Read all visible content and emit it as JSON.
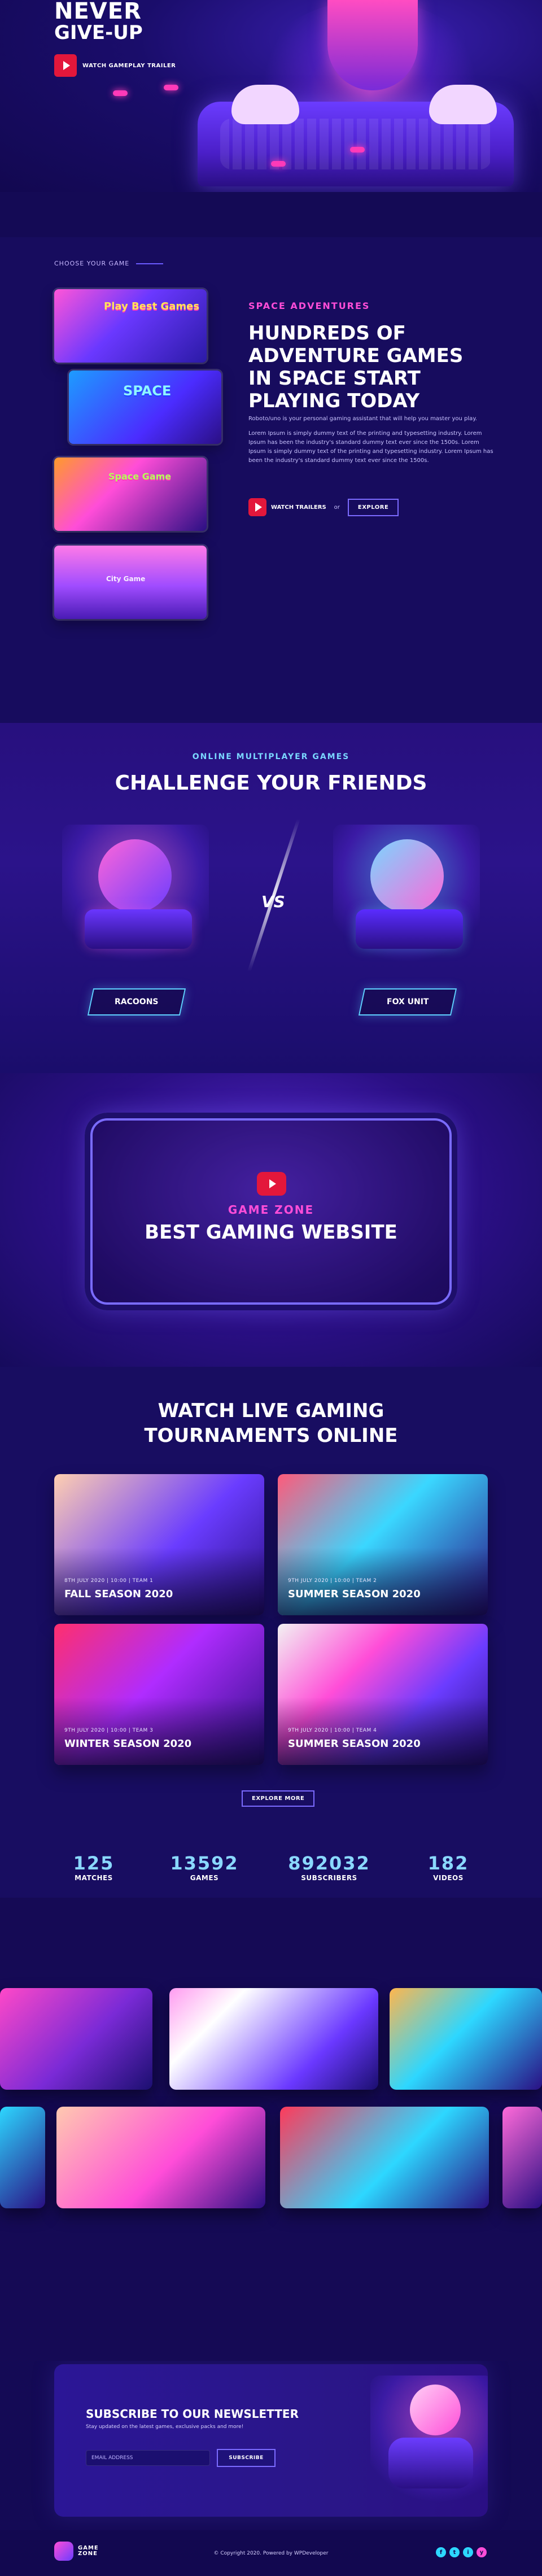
{
  "hero": {
    "title_line1": "NEVER",
    "title_line2": "GIVE-UP",
    "watch_label": "WATCH GAMEPLAY TRAILER"
  },
  "choose": {
    "eyebrow": "CHOOSE YOUR GAME",
    "tag": "SPACE ADVENTURES",
    "heading": "HUNDREDS OF ADVENTURE GAMES IN SPACE START PLAYING TODAY",
    "paragraph1": "Roboto/uno is your personal gaming assistant that will help you master you play.",
    "paragraph2": "Lorem Ipsum is simply dummy text of the printing and typesetting industry. Lorem Ipsum has been the industry's standard dummy text ever since the 1500s. Lorem Ipsum is simply dummy text of the printing and typesetting industry. Lorem Ipsum has been the industry's standard dummy text ever since the 1500s.",
    "watch_label": "WATCH TRAILERS",
    "or_label": "or",
    "explore_label": "EXPLORE",
    "thumbs": [
      {
        "title": "Play Best Games"
      },
      {
        "title": "SPACE"
      },
      {
        "title": "Space Game"
      },
      {
        "title": "City Game"
      }
    ]
  },
  "challenge": {
    "tag": "ONLINE MULTIPLAYER GAMES",
    "heading": "CHALLENGE YOUR FRIENDS",
    "vs": "VS",
    "team_left": "RACOONS",
    "team_right": "FOX UNIT"
  },
  "zone": {
    "tag": "GAME ZONE",
    "heading": "BEST GAMING WEBSITE"
  },
  "tournaments": {
    "heading_line1": "WATCH LIVE GAMING",
    "heading_line2": "TOURNAMENTS ONLINE",
    "cards": [
      {
        "date": "8TH JULY 2020 | 10:00 | TEAM 1",
        "title": "FALL SEASON 2020"
      },
      {
        "date": "9TH JULY 2020 | 10:00 | TEAM 2",
        "title": "SUMMER SEASON 2020"
      },
      {
        "date": "9TH JULY 2020 | 10:00 | TEAM 3",
        "title": "WINTER SEASON 2020"
      },
      {
        "date": "9TH JULY 2020 | 10:00 | TEAM 4",
        "title": "SUMMER SEASON 2020"
      }
    ],
    "explore_label": "EXPLORE MORE",
    "stats": [
      {
        "value": "125",
        "label": "MATCHES"
      },
      {
        "value": "13592",
        "label": "GAMES"
      },
      {
        "value": "892032",
        "label": "SUBSCRIBERS"
      },
      {
        "value": "182",
        "label": "VIDEOS"
      }
    ]
  },
  "newsletter": {
    "heading": "SUBSCRIBE TO OUR NEWSLETTER",
    "subtitle": "Stay updated on the latest games, exclusive packs and more!",
    "placeholder": "EMAIL ADDRESS",
    "button_label": "SUBSCRIBE"
  },
  "footer": {
    "logo_line1": "GAME",
    "logo_line2": "ZONE",
    "copyright": "© Copyright 2020. Powered by WPDeveloper",
    "social": [
      {
        "icon": "facebook-icon",
        "label": "f"
      },
      {
        "icon": "twitter-icon",
        "label": "t"
      },
      {
        "icon": "instagram-icon",
        "label": "i"
      },
      {
        "icon": "youtube-icon",
        "label": "y"
      }
    ]
  },
  "colors": {
    "bg": "#140a55",
    "accent_pink": "#ff4dd8",
    "accent_blue": "#2dd7ff",
    "play_red": "#e3173b"
  }
}
